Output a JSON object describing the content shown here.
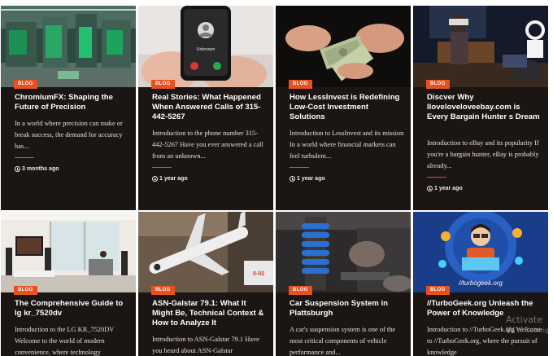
{
  "cards": [
    {
      "badge": "BLOG",
      "title": "ChromiumFX: Shaping the Future of Precision",
      "excerpt": "In a world where precision can make or break success, the demand for accuracy has...",
      "time": "3 months ago",
      "image": "industrial-machinery-photo"
    },
    {
      "badge": "BLOG",
      "title": "Real Stories: What Happened When Answered Calls of 315-442-5267",
      "excerpt": "Introduction to the phone number 315-442-5267 Have you ever answered a call from an unknown...",
      "time": "1 year ago",
      "image": "incoming-call-phone-photo",
      "phone_label": "Unknown"
    },
    {
      "badge": "BLOG",
      "title": "How LessInvest is Redefining Low-Cost Investment Solutions",
      "excerpt": "Introduction to LessInvest and its mission In a world where financial markets can feel turbulent...",
      "time": "1 year ago",
      "image": "hands-counting-money-photo"
    },
    {
      "badge": "BLOG",
      "title": "Discver Why Iloveloveloveebay.com is Every Bargain Hunter s Dream",
      "excerpt": "Introduction to eBay and its popularity If you're a bargain hunter, eBay is probably already...",
      "time": "1 year ago",
      "image": "vr-headset-room-photo"
    },
    {
      "badge": "BLOG",
      "title": "The Comprehensive Guide to lg kr_7520dv",
      "excerpt": "Introduction to the LG KR_7520DV Welcome to the world of modern convenience, where technology",
      "image": "living-room-tv-photo"
    },
    {
      "badge": "BLOG",
      "title": "ASN-Galstar 79.1: What It Might Be, Technical Context & How to Analyze It",
      "excerpt": "Introduction to ASN-Galstar 79.1 Have you heard about ASN-Galstar",
      "image": "aircraft-models-photo",
      "plane_label": "0-02"
    },
    {
      "badge": "BLOG",
      "title": "Car Suspension System in Plattsburgh",
      "excerpt": "A car's suspension system is one of the most critical components of vehicle performance and...",
      "image": "car-suspension-photo"
    },
    {
      "badge": "BLOG",
      "title": "//TurboGeek.org Unleash the Power of Knowledge",
      "excerpt": "Introduction to //TurboGeek.org Welcome to //TurboGeek.org, where the pursuit of knowledge",
      "image": "turbogeek-illustration",
      "image_caption": "//turbogeek.org"
    }
  ],
  "watermark": {
    "title": "Activate W",
    "subtitle": "Go to Setting"
  },
  "colors": {
    "card_bg": "#1b1514",
    "accent": "#e8501f"
  }
}
